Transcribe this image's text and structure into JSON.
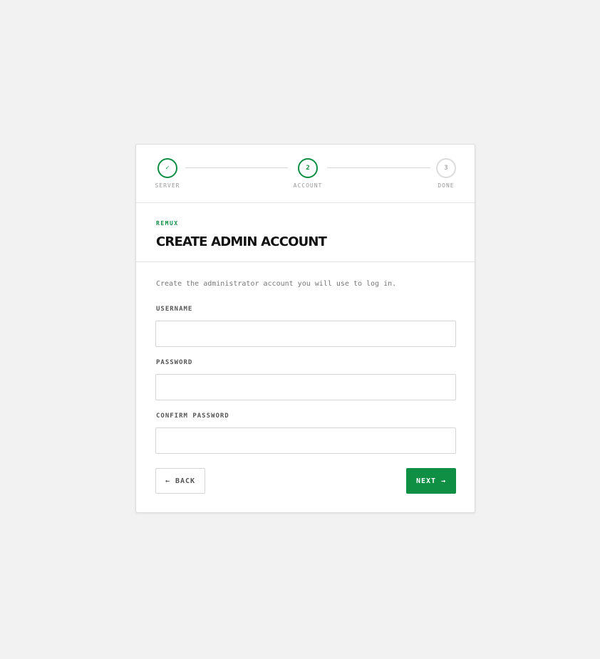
{
  "colors": {
    "accent": "#0e8f44",
    "background": "#f2f2f2",
    "card": "#ffffff"
  },
  "stepper": {
    "steps": [
      {
        "label": "SERVER",
        "marker": "✓",
        "state": "done"
      },
      {
        "label": "ACCOUNT",
        "marker": "2",
        "state": "active"
      },
      {
        "label": "DONE",
        "marker": "3",
        "state": "pending"
      }
    ]
  },
  "header": {
    "eyebrow": "REMUX",
    "title": "CREATE ADMIN ACCOUNT"
  },
  "form": {
    "description": "Create the administrator account you will use to log in.",
    "username": {
      "label": "USERNAME",
      "value": "",
      "placeholder": ""
    },
    "password": {
      "label": "PASSWORD",
      "value": "",
      "placeholder": ""
    },
    "confirm_password": {
      "label": "CONFIRM PASSWORD",
      "value": "",
      "placeholder": ""
    }
  },
  "actions": {
    "back_label": "← BACK",
    "next_label": "NEXT →"
  }
}
